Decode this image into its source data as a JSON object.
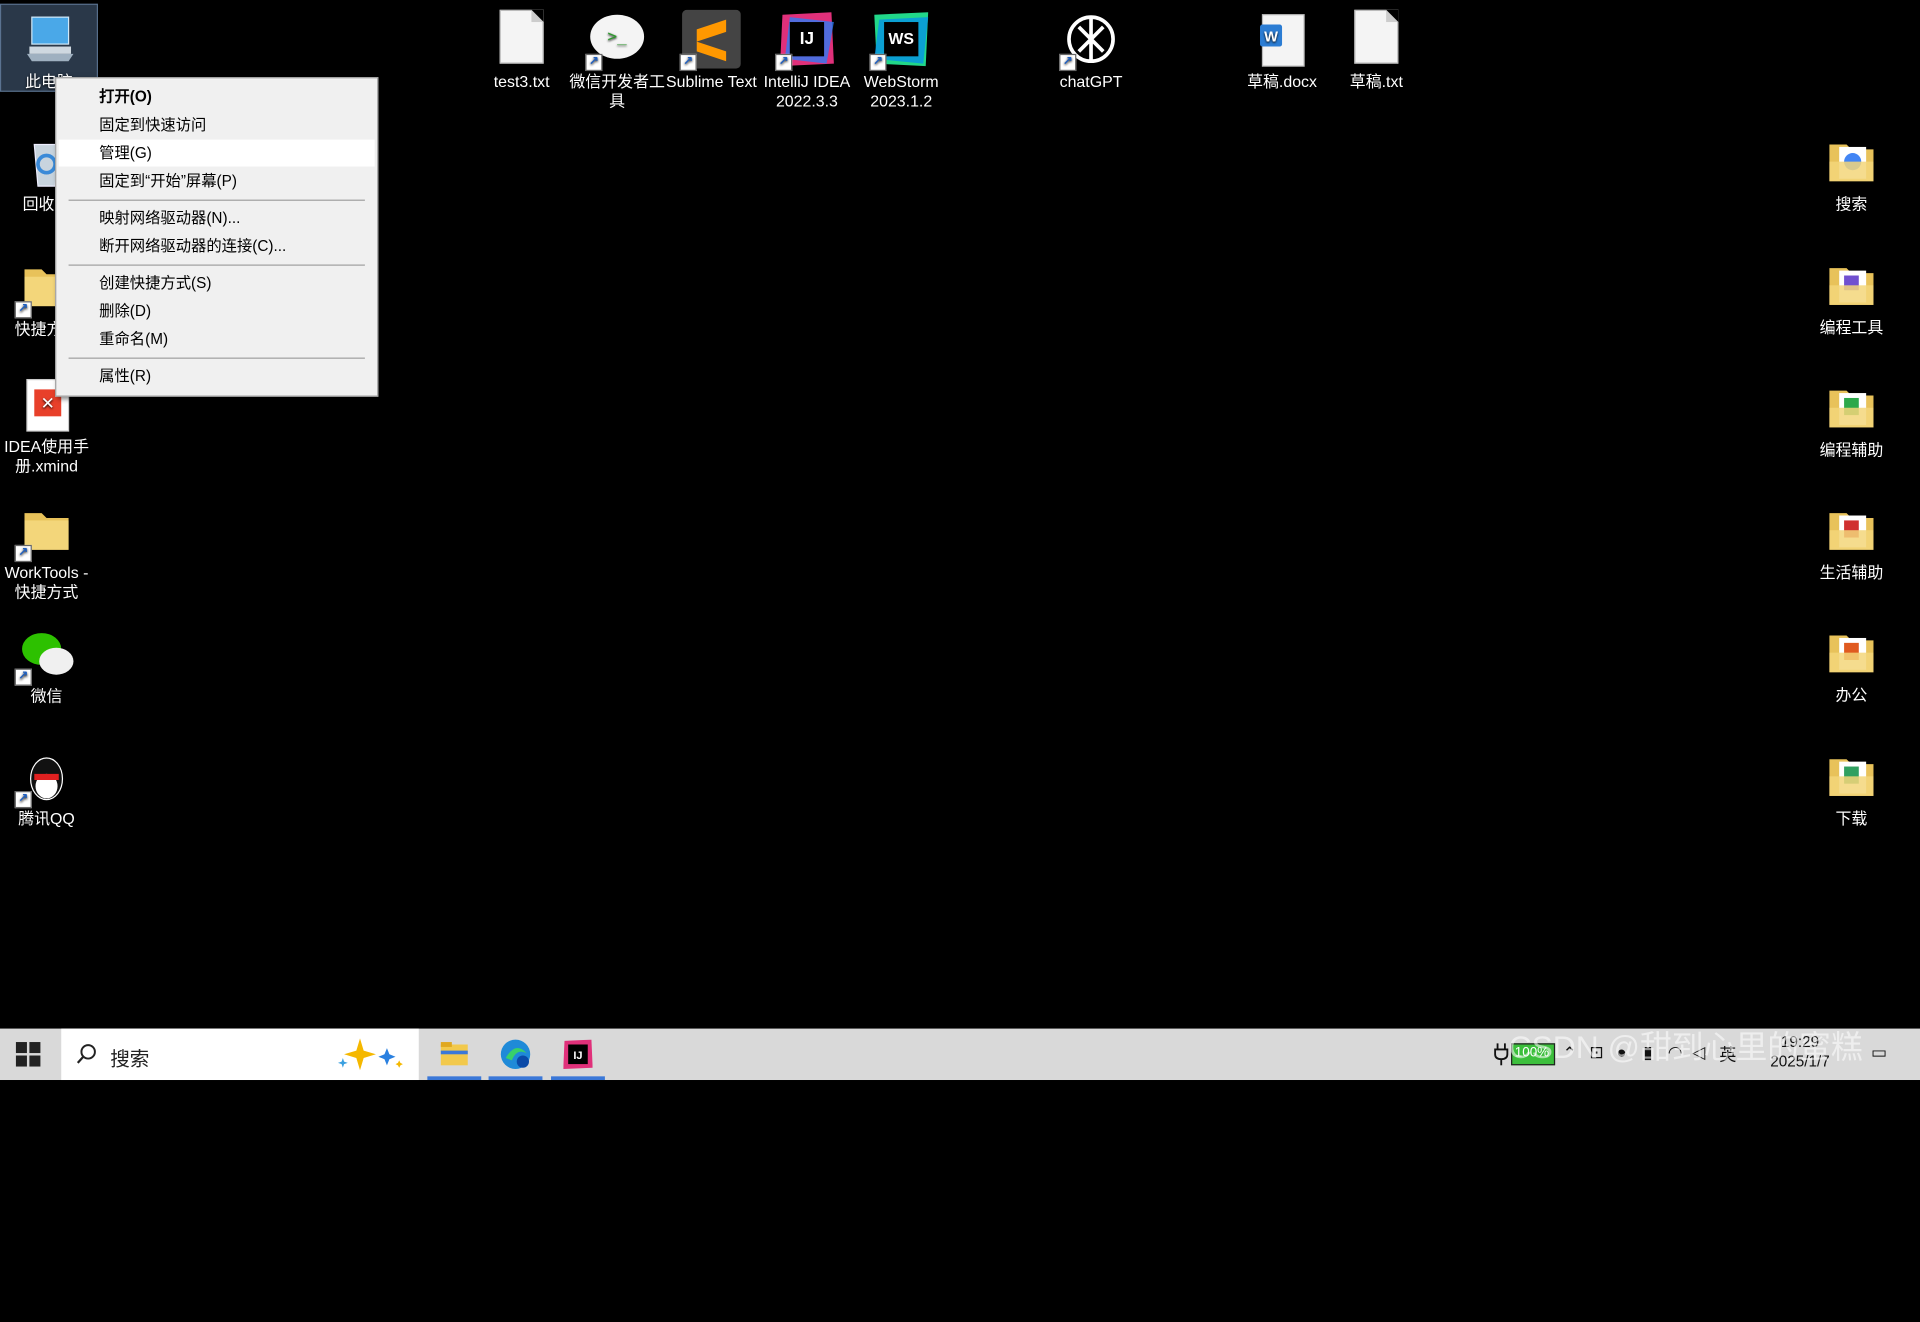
{
  "desktop_left": [
    {
      "label": "此电脑",
      "icon": "computer-icon"
    },
    {
      "label": "回收站",
      "icon": "recycle-bin-icon"
    },
    {
      "label": "快捷方式",
      "icon": "folder-icon"
    },
    {
      "label": "IDEA使用手册.xmind",
      "icon": "xmind-file-icon"
    },
    {
      "label": "WorkTools - 快捷方式",
      "icon": "folder-icon"
    },
    {
      "label": "微信",
      "icon": "wechat-icon"
    },
    {
      "label": "腾讯QQ",
      "icon": "qq-icon"
    }
  ],
  "desktop_top": [
    {
      "label": "test3.txt",
      "icon": "txt-file-icon"
    },
    {
      "label": "微信开发者工具",
      "icon": "wechat-devtools-icon"
    },
    {
      "label": "Sublime Text",
      "icon": "sublime-text-icon"
    },
    {
      "label": "IntelliJ IDEA 2022.3.3",
      "icon": "intellij-idea-icon"
    },
    {
      "label": "WebStorm 2023.1.2",
      "icon": "webstorm-icon"
    },
    {
      "label": "chatGPT",
      "icon": "chatgpt-icon"
    },
    {
      "label": "草稿.docx",
      "icon": "word-file-icon"
    },
    {
      "label": "草稿.txt",
      "icon": "txt-file-icon"
    }
  ],
  "desktop_right": [
    {
      "label": "搜索",
      "icon": "folder-icon"
    },
    {
      "label": "编程工具",
      "icon": "folder-icon"
    },
    {
      "label": "编程辅助",
      "icon": "folder-icon"
    },
    {
      "label": "生活辅助",
      "icon": "folder-icon"
    },
    {
      "label": "办公",
      "icon": "folder-icon"
    },
    {
      "label": "下载",
      "icon": "folder-icon"
    }
  ],
  "context_menu": {
    "items": [
      "打开(O)",
      "固定到快速访问",
      "管理(G)",
      "固定到“开始”屏幕(P)",
      "映射网络驱动器(N)...",
      "断开网络驱动器的连接(C)...",
      "创建快捷方式(S)",
      "删除(D)",
      "重命名(M)",
      "属性(R)"
    ]
  },
  "taskbar": {
    "search_placeholder": "搜索",
    "battery": "100%",
    "ime": "英",
    "time": "19:29",
    "date": "2025/1/7"
  },
  "watermark": "CSDN @甜到心里的蜜糕",
  "colors": {
    "desktop_bg": "#000000",
    "taskbar_bg": "#d9d9d9",
    "menu_bg": "#f0f0f0",
    "accent": "#3b78d8"
  }
}
